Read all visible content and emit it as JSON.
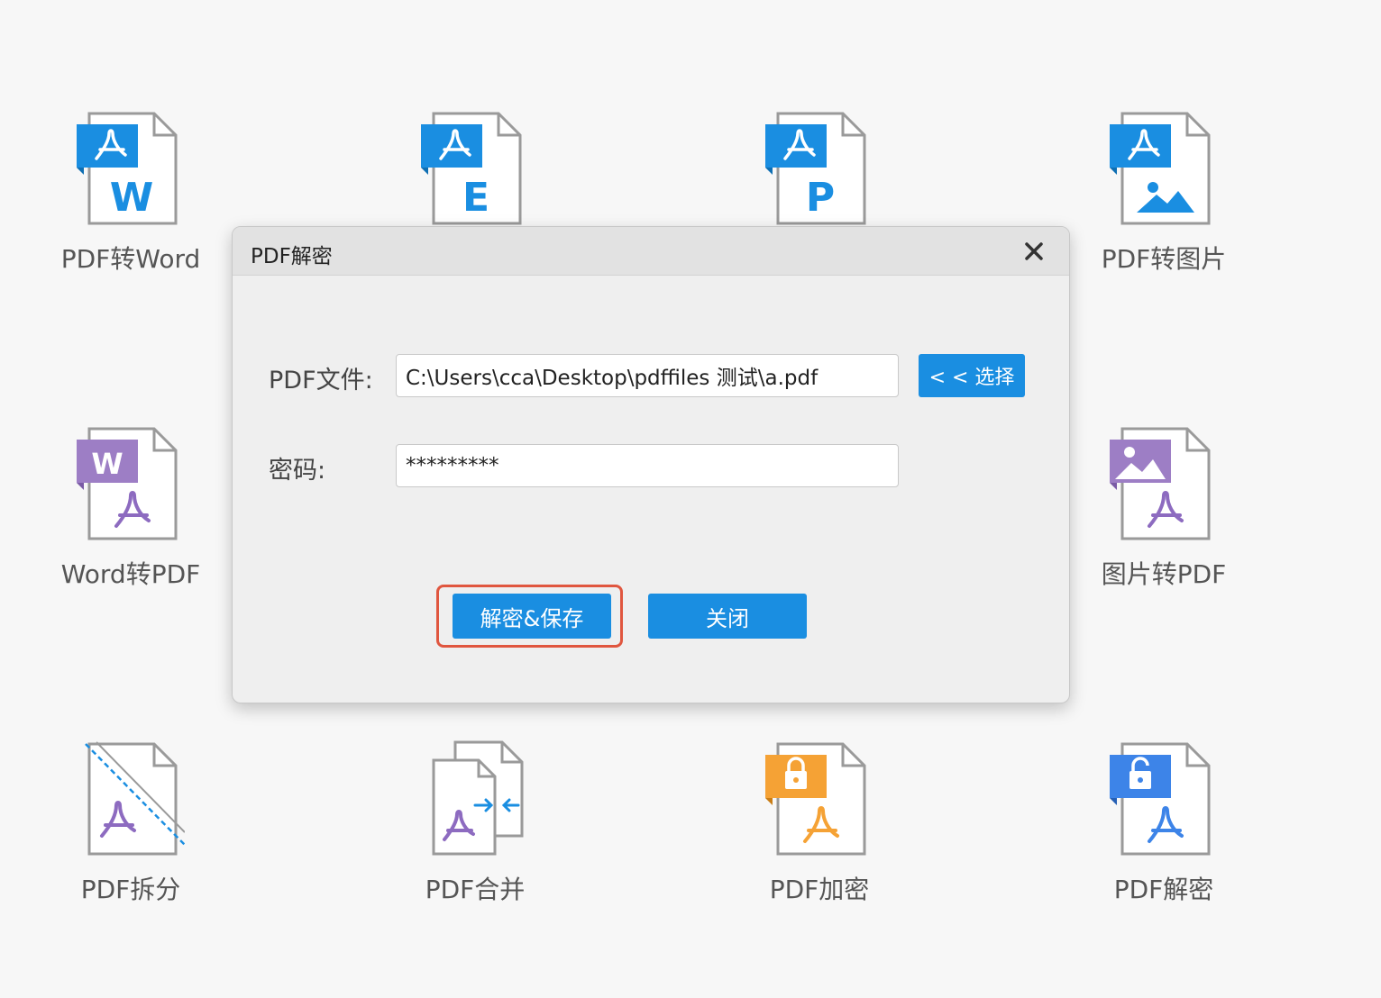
{
  "tools": [
    {
      "label": "PDF转Word",
      "icon": "pdf-to-word-icon",
      "letter": "W"
    },
    {
      "label": "",
      "icon": "pdf-to-excel-icon",
      "letter": "E"
    },
    {
      "label": "",
      "icon": "pdf-to-ppt-icon",
      "letter": "P"
    },
    {
      "label": "PDF转图片",
      "icon": "pdf-to-image-icon"
    },
    {
      "label": "Word转PDF",
      "icon": "word-to-pdf-icon",
      "letter": "W"
    },
    {
      "label": "图片转PDF",
      "icon": "image-to-pdf-icon"
    },
    {
      "label": "PDF拆分",
      "icon": "pdf-split-icon"
    },
    {
      "label": "PDF合并",
      "icon": "pdf-merge-icon"
    },
    {
      "label": "PDF加密",
      "icon": "pdf-encrypt-icon"
    },
    {
      "label": "PDF解密",
      "icon": "pdf-decrypt-icon"
    }
  ],
  "colors": {
    "pdf_blue": "#1a8ee1",
    "word_purple": "#9d7ec5",
    "pdf_purple": "#8d6bc0",
    "lock_orange": "#f5a235",
    "unlock_blue": "#3d84e8",
    "highlight_red": "#e0563f"
  },
  "dialog": {
    "title": "PDF解密",
    "close_icon": "close-icon",
    "file_label": "PDF文件:",
    "file_value": "C:\\Users\\cca\\Desktop\\pdffiles 测试\\a.pdf",
    "select_button": "< < 选择",
    "password_label": "密码:",
    "password_value": "*********",
    "decrypt_save_button": "解密&保存",
    "close_button": "关闭"
  }
}
